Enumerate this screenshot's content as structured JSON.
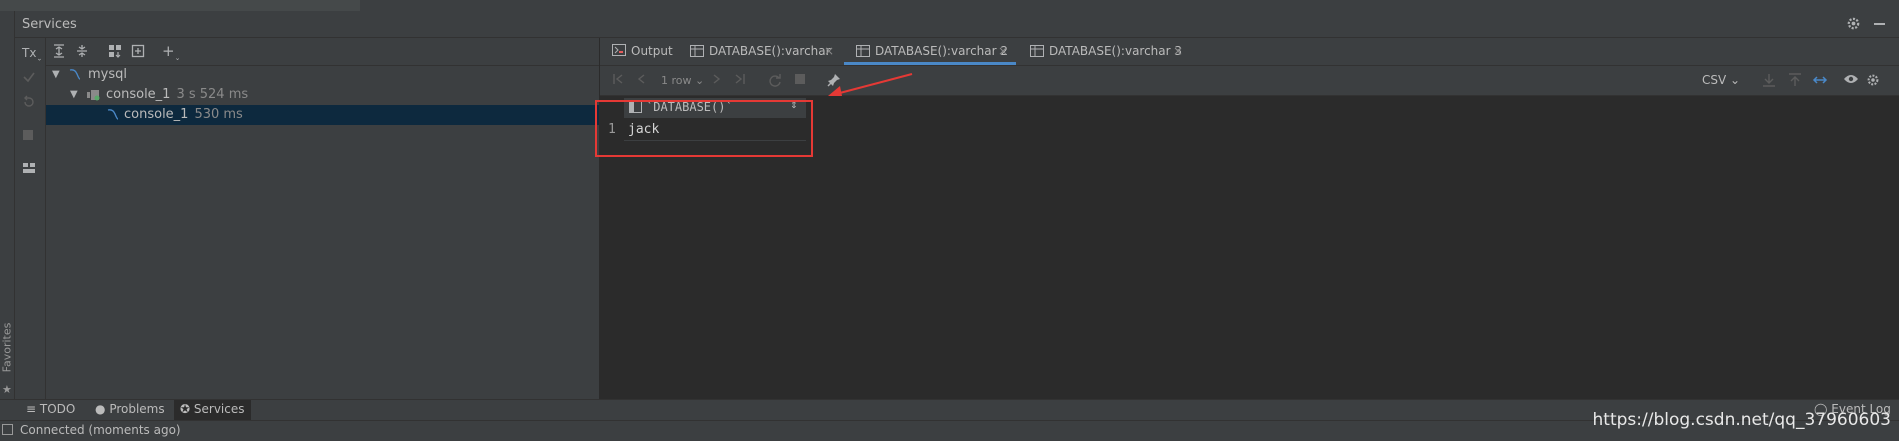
{
  "header": {
    "title": "Services"
  },
  "favorites": {
    "label": "Favorites"
  },
  "tree": {
    "items": [
      {
        "label": "mysql",
        "time": ""
      },
      {
        "label": "console_1",
        "time": "3 s 524 ms"
      },
      {
        "label": "console_1",
        "time": "530 ms"
      }
    ]
  },
  "tabs": [
    {
      "label": "Output"
    },
    {
      "label": "DATABASE():varchar"
    },
    {
      "label": "DATABASE():varchar 2"
    },
    {
      "label": "DATABASE():varchar 3"
    }
  ],
  "tab_close_glyph": "×",
  "results_toolbar": {
    "rows": "1 row",
    "format": "CSV"
  },
  "grid": {
    "column": "`DATABASE()`",
    "rows": [
      {
        "num": "1",
        "value": "jack"
      }
    ]
  },
  "bottom_tabs": {
    "todo": "TODO",
    "problems": "Problems",
    "services": "Services",
    "event_log": "Event Log"
  },
  "status": {
    "text": "Connected (moments ago)"
  },
  "watermark": "https://blog.csdn.net/qq_37960603",
  "colors": {
    "accent": "#4a88c7",
    "highlight": "#e53935",
    "selection": "#0d293e"
  }
}
